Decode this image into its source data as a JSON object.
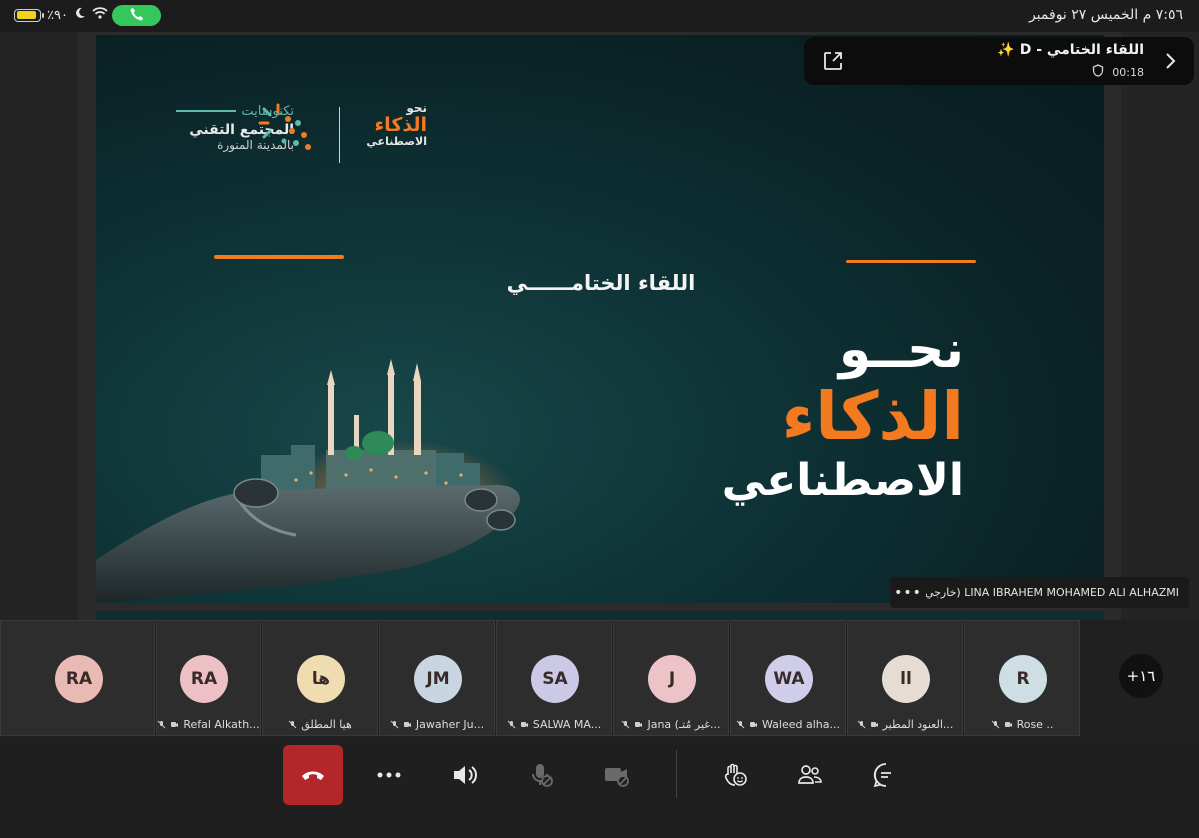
{
  "status_bar": {
    "battery_text": "٪٩٠",
    "battery_level": 0.9,
    "datetime": "٧:٥٦ م   الخميس ٢٧ نوفمبر"
  },
  "meeting_panel": {
    "title": "اللقاء الختامي - D ✨",
    "duration": "00:18"
  },
  "slide": {
    "brand_name": "تكنوسايت",
    "brand_sub1": "المجتمع التقني",
    "brand_sub2": "بالمدينة المنورة",
    "logo_line1": "نحو",
    "logo_line2": "الذكاء",
    "logo_line3": "الاصطناعي",
    "headline": "اللقاء الختامــــــي",
    "title_line1": "نحــو",
    "title_line2": "الذكاء",
    "title_line3": "الاصطناعي"
  },
  "presenter": {
    "name": "LINA IBRAHEM MOHAMED ALI ALHAZMI (خارجي)"
  },
  "participants": [
    {
      "initials": "RA",
      "name": "",
      "color": "#e9b9b3"
    },
    {
      "initials": "RA",
      "name": "Refal Alkath...",
      "color": "#ecc0c4"
    },
    {
      "initials": "ها",
      "name": "هيا المطلق",
      "color": "#efdcb0"
    },
    {
      "initials": "JM",
      "name": "Jawaher Ju...",
      "color": "#c9d6e2"
    },
    {
      "initials": "SA",
      "name": "SALWA MA...",
      "color": "#ccc9e6"
    },
    {
      "initials": "J",
      "name": "Jana (غير مُتـ...",
      "color": "#ecc4c7"
    },
    {
      "initials": "WA",
      "name": "Waleed alha...",
      "color": "#cfcdea"
    },
    {
      "initials": "اا",
      "name": "العنود المطير...",
      "color": "#e5ddd4"
    },
    {
      "initials": "R",
      "name": "Rose ..",
      "color": "#cfdde4"
    }
  ],
  "more_participants": "+١٦"
}
